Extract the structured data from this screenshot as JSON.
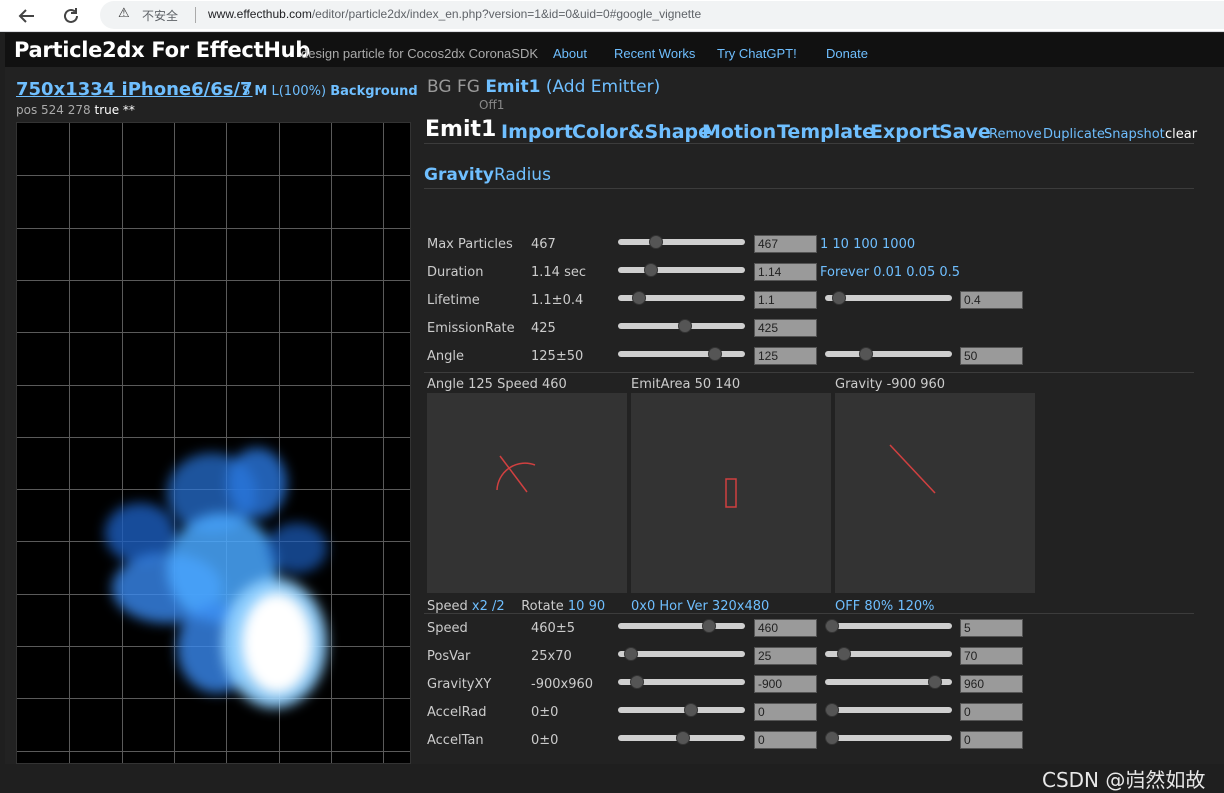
{
  "browser": {
    "back_icon": "back-arrow-icon",
    "reload_icon": "reload-icon",
    "insecure_label": "不安全",
    "url_host": "www.effecthub.com",
    "url_path": "/editor/particle2dx/index_en.php?version=1&id=0&uid=0#google_vignette"
  },
  "header": {
    "brand": "Particle2dx For EffectHub",
    "tagline": "design particle for Cocos2dx CoronaSDK",
    "links": [
      "About",
      "Recent Works",
      "Try ChatGPT!",
      "Donate"
    ]
  },
  "preview": {
    "device": "750x1334 iPhone6/6s/7",
    "size_s": "S",
    "size_m": "M",
    "size_l": "L(100%)",
    "background": "Background",
    "pos_text": "pos 524 278",
    "pos_flag": "true **"
  },
  "emitters": {
    "bg": "BG",
    "fg": "FG",
    "current": "Emit1",
    "add": "(Add Emitter)",
    "off": "Off1"
  },
  "tabs": {
    "main": "Emit1",
    "items": [
      "Import",
      "Color&Shape",
      "Motion",
      "Template",
      "Export",
      "Save"
    ],
    "small": [
      "Remove",
      "Duplicate",
      "Snapshot",
      "clear"
    ]
  },
  "mode": {
    "gravity": "Gravity",
    "radius": "Radius"
  },
  "rows_top": [
    {
      "label": "Max Particles",
      "value": "467",
      "box1": "467",
      "s1": 0.27,
      "links": "1 10 100 1000"
    },
    {
      "label": "Duration",
      "value": "1.14 sec",
      "box1": "1.14",
      "s1": 0.23,
      "links": "Forever 0.01 0.05 0.5"
    },
    {
      "label": "Lifetime",
      "value": "1.1±0.4",
      "box1": "1.1",
      "s1": 0.12,
      "box2": "0.4",
      "s2": 0.06
    },
    {
      "label": "EmissionRate",
      "value": "425",
      "box1": "425",
      "s1": 0.53
    },
    {
      "label": "Angle",
      "value": "125±50",
      "box1": "125",
      "s1": 0.8,
      "box2": "50",
      "s2": 0.3
    }
  ],
  "panels": [
    {
      "title": "Angle 125 Speed 460",
      "bottom_plain": "Speed",
      "bottom_links": "x2 /2",
      "bottom_plain2": "Rotate",
      "bottom_links2": "10 90"
    },
    {
      "title": "EmitArea 50 140",
      "bottom_links": "0x0 Hor Ver 320x480"
    },
    {
      "title": "Gravity -900 960",
      "bottom_links": "OFF 80% 120%"
    }
  ],
  "rows_bottom": [
    {
      "label": "Speed",
      "value": "460±5",
      "box1": "460",
      "s1": 0.74,
      "box2": "5",
      "s2": 0.0
    },
    {
      "label": "PosVar",
      "value": "25x70",
      "box1": "25",
      "s1": 0.05,
      "box2": "70",
      "s2": 0.11
    },
    {
      "label": "GravityXY",
      "value": "-900x960",
      "box1": "-900",
      "s1": 0.11,
      "box2": "960",
      "s2": 0.91
    },
    {
      "label": "AccelRad",
      "value": "0±0",
      "box1": "0",
      "s1": 0.58,
      "box2": "0",
      "s2": 0.0
    },
    {
      "label": "AccelTan",
      "value": "0±0",
      "box1": "0",
      "s1": 0.51,
      "box2": "0",
      "s2": 0.0
    }
  ],
  "watermark": "CSDN @岿然如故",
  "colors": {
    "accent": "#6fbfff",
    "particle": "#4aa8ff",
    "vector": "#d04040"
  }
}
